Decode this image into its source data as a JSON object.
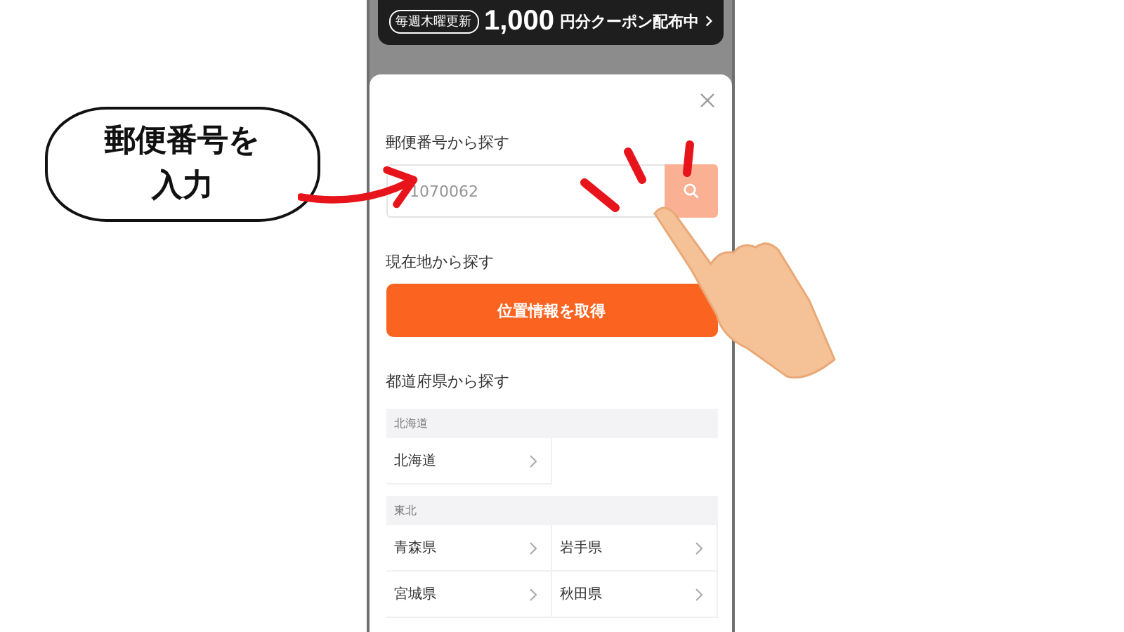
{
  "banner": {
    "badge": "毎週木曜更新",
    "amount": "1,000",
    "text": "円分クーポン配布中"
  },
  "modal": {
    "postal": {
      "label": "郵便番号から探す",
      "placeholder": "1070062"
    },
    "location": {
      "label": "現在地から探す",
      "button": "位置情報を取得"
    },
    "prefectures": {
      "label": "都道府県から探す",
      "regions": [
        {
          "name": "北海道",
          "items": [
            "北海道"
          ]
        },
        {
          "name": "東北",
          "items": [
            "青森県",
            "岩手県",
            "宮城県",
            "秋田県"
          ]
        }
      ]
    }
  },
  "callout": {
    "text": "郵便番号を入力"
  }
}
